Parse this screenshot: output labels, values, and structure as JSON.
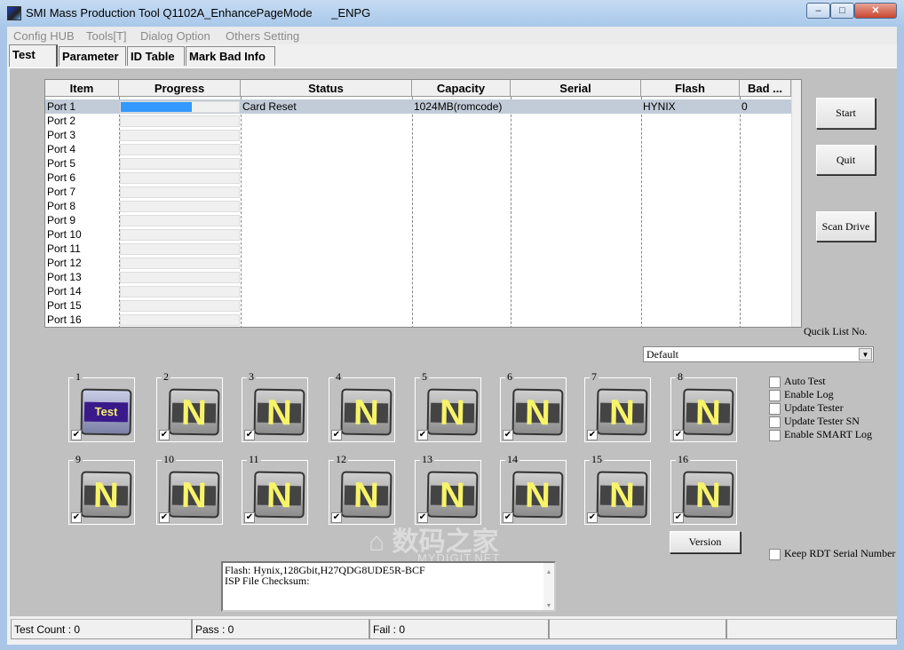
{
  "window": {
    "title": "SMI Mass Production Tool Q1102A_EnhancePageMode      _ENPG",
    "minimize": "–",
    "maximize": "□",
    "close": "✕"
  },
  "menu": [
    "Config HUB",
    "Tools[T]",
    "Dialog Option",
    "Others Setting"
  ],
  "tabs": [
    "Test",
    "Parameter",
    "ID Table",
    "Mark Bad Info"
  ],
  "table": {
    "columns": [
      "Item",
      "Progress",
      "Status",
      "Capacity",
      "Serial",
      "Flash",
      "Bad ..."
    ],
    "rows": [
      {
        "item": "Port 1",
        "progress": 60,
        "status": "Card Reset",
        "capacity": "1024MB(romcode)",
        "serial": "",
        "flash": "HYNIX",
        "bad": "0"
      },
      {
        "item": "Port 2"
      },
      {
        "item": "Port 3"
      },
      {
        "item": "Port 4"
      },
      {
        "item": "Port 5"
      },
      {
        "item": "Port 6"
      },
      {
        "item": "Port 7"
      },
      {
        "item": "Port 8"
      },
      {
        "item": "Port 9"
      },
      {
        "item": "Port 10"
      },
      {
        "item": "Port 11"
      },
      {
        "item": "Port 12"
      },
      {
        "item": "Port 13"
      },
      {
        "item": "Port 14"
      },
      {
        "item": "Port 15"
      },
      {
        "item": "Port 16"
      }
    ]
  },
  "buttons": {
    "start": "Start",
    "quit": "Quit",
    "scan": "Scan Drive",
    "version": "Version"
  },
  "quick_list": {
    "label": "Qucik List No.",
    "value": "Default"
  },
  "ports": [
    {
      "n": "1",
      "icon": "Test",
      "checked": true
    },
    {
      "n": "2",
      "icon": "N",
      "checked": true
    },
    {
      "n": "3",
      "icon": "N",
      "checked": true
    },
    {
      "n": "4",
      "icon": "N",
      "checked": true
    },
    {
      "n": "5",
      "icon": "N",
      "checked": true
    },
    {
      "n": "6",
      "icon": "N",
      "checked": true
    },
    {
      "n": "7",
      "icon": "N",
      "checked": true
    },
    {
      "n": "8",
      "icon": "N",
      "checked": true
    },
    {
      "n": "9",
      "icon": "N",
      "checked": true
    },
    {
      "n": "10",
      "icon": "N",
      "checked": true
    },
    {
      "n": "11",
      "icon": "N",
      "checked": true
    },
    {
      "n": "12",
      "icon": "N",
      "checked": true
    },
    {
      "n": "13",
      "icon": "N",
      "checked": true
    },
    {
      "n": "14",
      "icon": "N",
      "checked": true
    },
    {
      "n": "15",
      "icon": "N",
      "checked": true
    },
    {
      "n": "16",
      "icon": "N",
      "checked": true
    }
  ],
  "options": [
    {
      "label": "Auto Test",
      "checked": false
    },
    {
      "label": "Enable Log",
      "checked": false
    },
    {
      "label": "Update Tester",
      "checked": false
    },
    {
      "label": "Update Tester SN",
      "checked": false
    },
    {
      "label": "Enable SMART Log",
      "checked": false
    }
  ],
  "keep_rdt": {
    "label": "Keep RDT Serial Number",
    "checked": false
  },
  "log": [
    "Flash: Hynix,128Gbit,H27QDG8UDE5R-BCF",
    "ISP File Checksum:"
  ],
  "statusbar": [
    "Test Count : 0",
    "Pass : 0",
    "Fail : 0",
    "",
    ""
  ],
  "watermark": {
    "cn": "数码之家",
    "en": "MYDIGIT.NET"
  },
  "colors": {
    "progress": "#3399ff",
    "selected_row": "#c2ccd8",
    "panel": "#c0c0c0"
  }
}
